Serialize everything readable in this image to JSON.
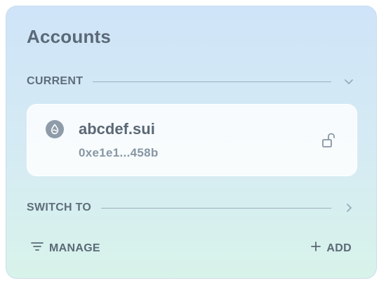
{
  "panel": {
    "title": "Accounts"
  },
  "current_section": {
    "label": "CURRENT",
    "chevron_icon": "chevron-down-icon",
    "account": {
      "name": "abcdef.sui",
      "address": "0xe1e1...458b",
      "icon": "sui-logo-icon",
      "lock_icon": "unlocked-icon"
    }
  },
  "switch_section": {
    "label": "SWITCH TO",
    "chevron_icon": "chevron-right-icon"
  },
  "footer": {
    "manage_label": "MANAGE",
    "manage_icon": "filter-icon",
    "add_label": "ADD",
    "add_icon": "plus-icon"
  },
  "colors": {
    "panel_gradient_top": "#cfe4f8",
    "panel_gradient_bottom": "#d8f3ea",
    "text_primary": "#5a6876",
    "text_secondary": "#8796a4",
    "card_background": "#ffffff"
  }
}
